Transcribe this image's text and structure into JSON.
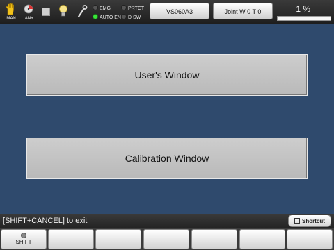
{
  "topbar": {
    "mode_icons": [
      {
        "name": "man",
        "label": "MAN"
      },
      {
        "name": "any",
        "label": "ANY"
      }
    ],
    "lamps": [
      {
        "label": "EMG",
        "on": false
      },
      {
        "label": "AUTO EN",
        "on": true
      },
      {
        "label": "PRTCT",
        "on": false
      },
      {
        "label": "D SW",
        "on": false
      }
    ],
    "robot_button": "VS060A3",
    "joint_button": "Joint  W 0 T 0",
    "speed_percent": "1 %",
    "speed_value": 0.01
  },
  "main": {
    "users_window_label": "User's Window",
    "calibration_window_label": "Calibration Window"
  },
  "statusline": {
    "message": "[SHIFT+CANCEL] to exit",
    "shortcut_label": "Shortcut"
  },
  "function_keys": [
    {
      "label": "SHIFT"
    },
    {
      "label": ""
    },
    {
      "label": ""
    },
    {
      "label": ""
    },
    {
      "label": ""
    },
    {
      "label": ""
    },
    {
      "label": ""
    }
  ],
  "colors": {
    "background": "#2f4a6d",
    "lamp_on": "#39e639",
    "speed_bar": "#3a8dde"
  }
}
